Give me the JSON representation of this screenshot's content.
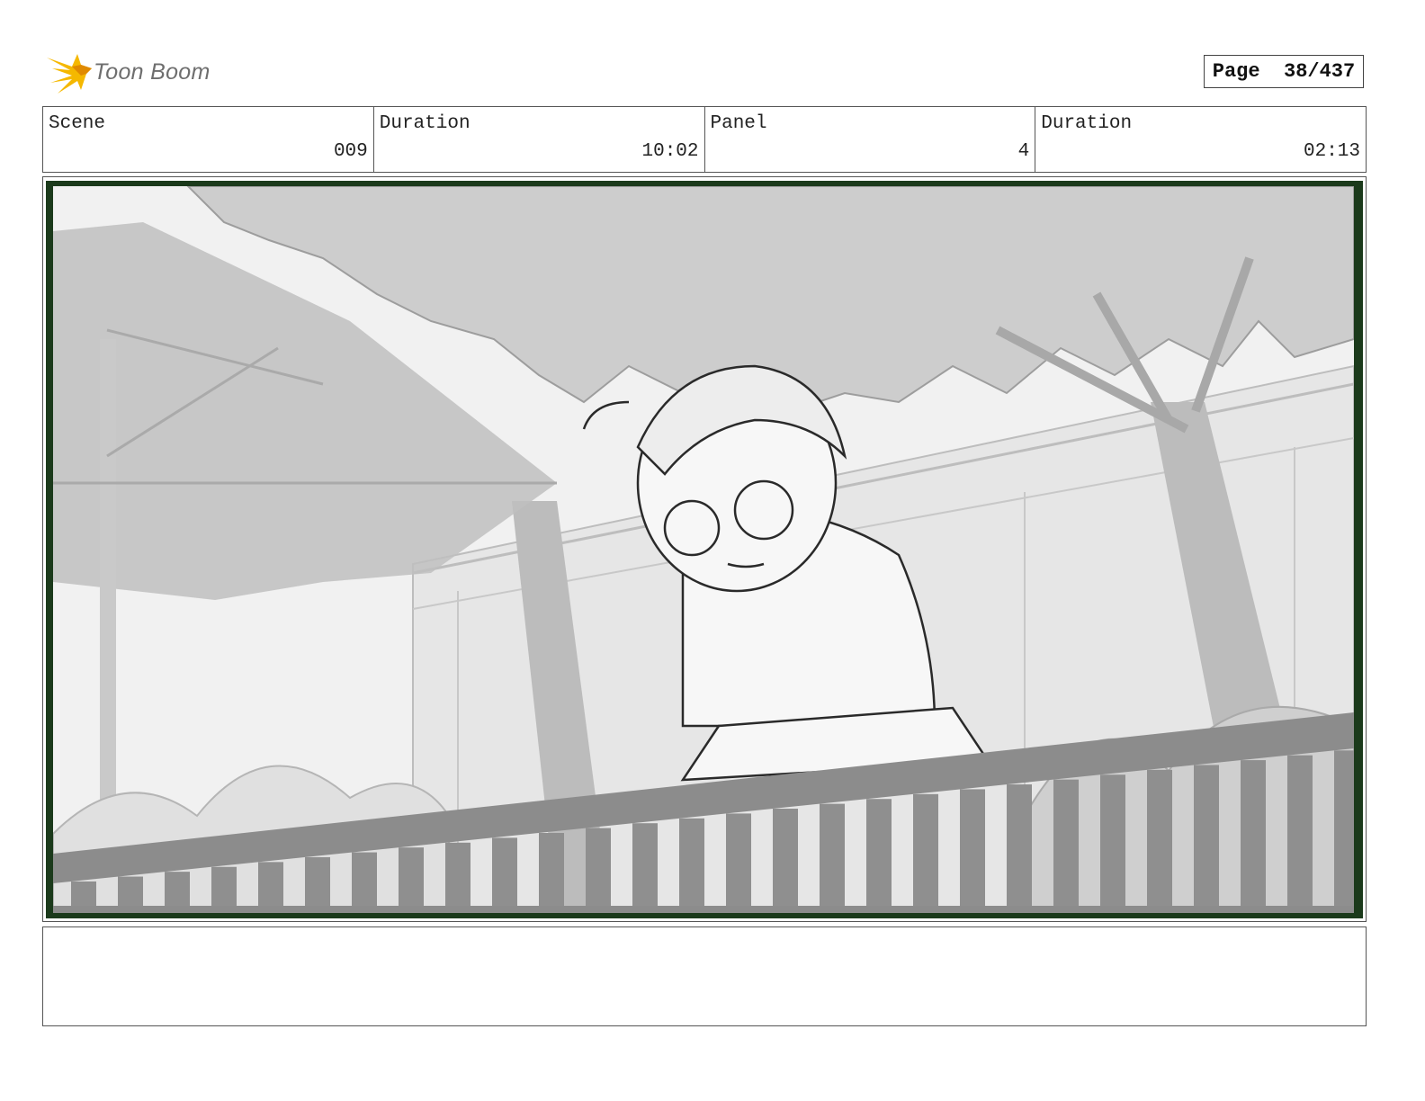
{
  "header": {
    "brand": "Toon Boom",
    "page_label": "Page",
    "page_number": "38/437"
  },
  "info": {
    "scene_label": "Scene",
    "scene_value": "009",
    "scene_duration_label": "Duration",
    "scene_duration_value": "10:02",
    "panel_label": "Panel",
    "panel_value": "4",
    "panel_duration_label": "Duration",
    "panel_duration_value": "02:13"
  },
  "colors": {
    "logo_accent": "#f5b800",
    "frame_border": "#1b3a1b"
  },
  "notes": ""
}
